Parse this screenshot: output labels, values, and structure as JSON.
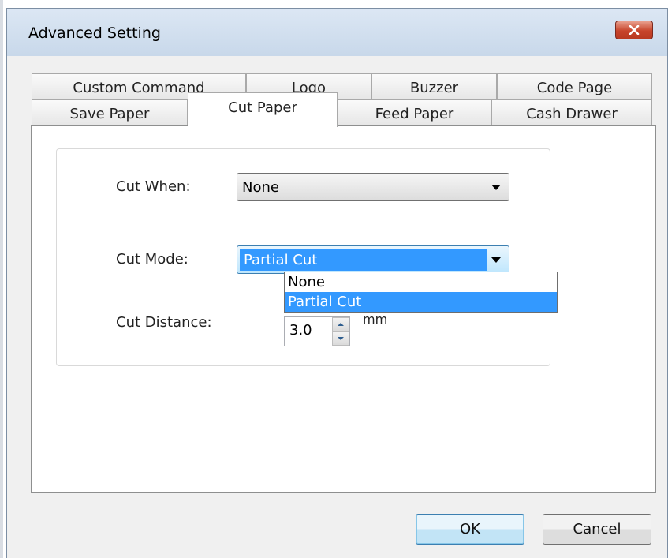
{
  "window": {
    "title": "Advanced Setting"
  },
  "tabs": {
    "row_back": [
      "Custom Command",
      "Logo",
      "Buzzer",
      "Code Page"
    ],
    "row_front": [
      "Save Paper",
      "Cut Paper",
      "Feed Paper",
      "Cash Drawer"
    ],
    "active": "Cut Paper"
  },
  "form": {
    "cut_when": {
      "label": "Cut When:",
      "value": "None"
    },
    "cut_mode": {
      "label": "Cut Mode:",
      "value": "Partial Cut",
      "options": [
        "None",
        "Partial Cut"
      ],
      "highlighted": "Partial Cut"
    },
    "cut_distance": {
      "label": "Cut Distance:",
      "value": "3.0",
      "unit": "mm"
    }
  },
  "buttons": {
    "ok": "OK",
    "cancel": "Cancel"
  },
  "icons": {
    "close": "close-icon",
    "dropdown": "chevron-down-icon"
  },
  "colors": {
    "selection": "#3399ff",
    "close_button": "#c7442b",
    "titlebar": "#d3e0ef"
  }
}
